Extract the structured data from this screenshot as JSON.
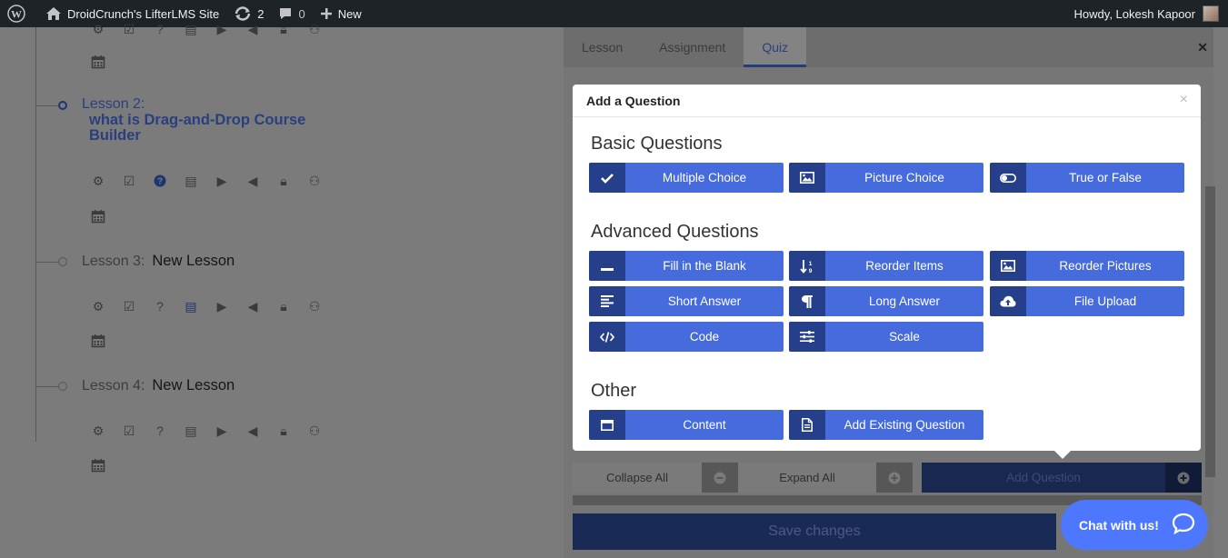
{
  "adminbar": {
    "site_name": "DroidCrunch's LifterLMS Site",
    "updates_count": "2",
    "comments_count": "0",
    "new_label": "New",
    "greeting": "Howdy, Lokesh Kapoor"
  },
  "lessons": [
    {
      "label": "Lesson 2:",
      "title": "what is Drag-and-Drop Course Builder"
    },
    {
      "label": "Lesson 3:",
      "title": "New Lesson"
    },
    {
      "label": "Lesson 4:",
      "title": "New Lesson"
    }
  ],
  "tabs": [
    "Lesson",
    "Assignment",
    "Quiz"
  ],
  "footer": {
    "collapse_all": "Collapse All",
    "expand_all": "Expand All",
    "add_question": "Add Question",
    "save_changes": "Save changes"
  },
  "chat": {
    "label": "Chat with us!"
  },
  "modal": {
    "title": "Add a Question",
    "close": "×",
    "sections": {
      "basic": "Basic Questions",
      "advanced": "Advanced Questions",
      "other": "Other"
    },
    "basic": [
      "Multiple Choice",
      "Picture Choice",
      "True or False"
    ],
    "advanced": [
      "Fill in the Blank",
      "Reorder Items",
      "Reorder Pictures",
      "Short Answer",
      "Long Answer",
      "File Upload",
      "Code",
      "Scale"
    ],
    "other": [
      "Content",
      "Add Existing Question"
    ]
  }
}
